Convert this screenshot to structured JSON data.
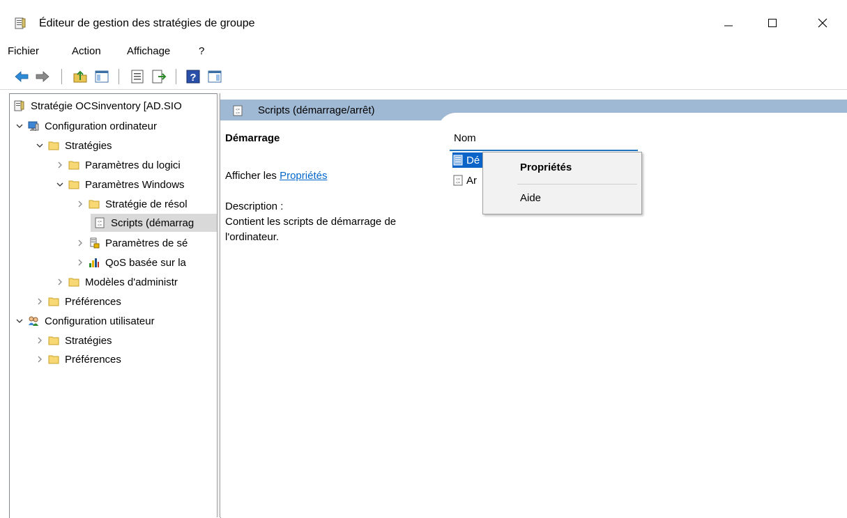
{
  "window": {
    "title": "Éditeur de gestion des stratégies de groupe"
  },
  "menu": [
    "Fichier",
    "Action",
    "Affichage",
    "?"
  ],
  "toolbar": [
    "back-icon",
    "forward-icon",
    "up-folder-icon",
    "show-hide-tree-icon",
    "properties-icon",
    "export-list-icon",
    "help-icon",
    "show-action-pane-icon"
  ],
  "tree": {
    "root": "Stratégie OCSinventory [AD.SIO",
    "computer_config": "Configuration ordinateur",
    "strategies": "Stratégies",
    "software_settings": "Paramètres du logici",
    "windows_settings": "Paramètres Windows",
    "name_resolution": "Stratégie de résol",
    "scripts": "Scripts (démarrag",
    "security_settings": "Paramètres de sé",
    "qos": "QoS basée sur la",
    "admin_templates": "Modèles d'administr",
    "preferences": "Préférences",
    "user_config": "Configuration utilisateur",
    "user_strategies": "Stratégies",
    "user_preferences": "Préférences"
  },
  "details": {
    "header": "Scripts (démarrage/arrêt)",
    "section_title": "Démarrage",
    "show_prefix": "Afficher les ",
    "show_link": "Propriétés",
    "description_label": "Description :",
    "description_line1": "Contient les scripts de démarrage de",
    "description_line2": "l'ordinateur."
  },
  "list": {
    "column": "Nom",
    "items": [
      "Dé",
      "Ar"
    ]
  },
  "context_menu": {
    "properties": "Propriétés",
    "help": "Aide"
  }
}
